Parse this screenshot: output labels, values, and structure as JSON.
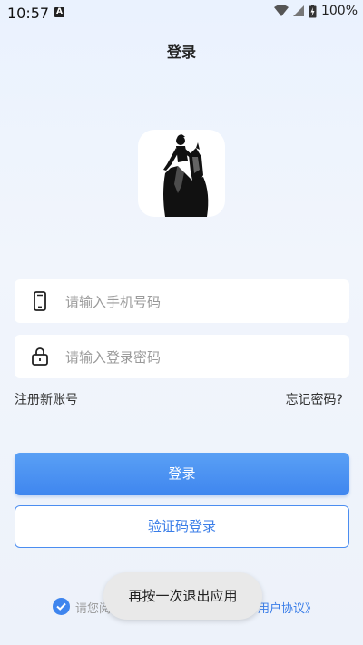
{
  "status_bar": {
    "time": "10:57",
    "app_badge": "A",
    "battery": "100%"
  },
  "page": {
    "title": "登录"
  },
  "phone_field": {
    "placeholder": "请输入手机号码",
    "icon": "phone-icon"
  },
  "password_field": {
    "placeholder": "请输入登录密码",
    "icon": "lock-icon"
  },
  "links": {
    "register": "注册新账号",
    "forgot": "忘记密码?"
  },
  "buttons": {
    "login": "登录",
    "sms_login": "验证码登录"
  },
  "agreement": {
    "prefix": "请您阅",
    "link": "用户协议》"
  },
  "toast": {
    "text": "再按一次退出应用"
  },
  "colors": {
    "accent": "#3f86ef",
    "background": "#eaf2fe"
  }
}
